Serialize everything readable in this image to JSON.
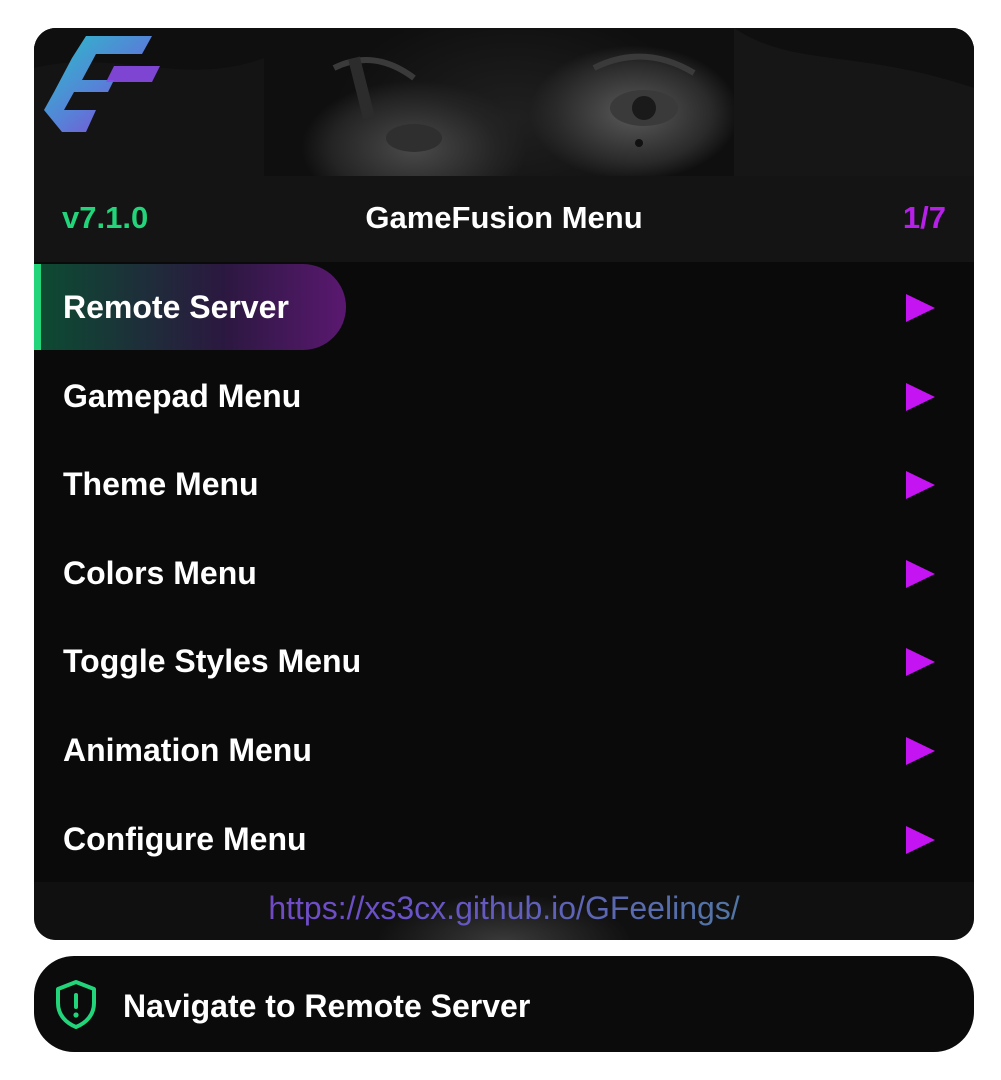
{
  "header": {
    "version": "v7.1.0",
    "title": "GameFusion Menu",
    "page_indicator": "1/7"
  },
  "menu": {
    "selected_index": 0,
    "items": [
      {
        "label": "Remote Server"
      },
      {
        "label": "Gamepad Menu"
      },
      {
        "label": "Theme Menu"
      },
      {
        "label": "Colors Menu"
      },
      {
        "label": "Toggle Styles Menu"
      },
      {
        "label": "Animation Menu"
      },
      {
        "label": "Configure Menu"
      }
    ]
  },
  "footer": {
    "url": "https://xs3cx.github.io/GFeelings/"
  },
  "notification": {
    "icon": "shield-alert-icon",
    "message": "Navigate to Remote Server"
  },
  "colors": {
    "version_green": "#22d47a",
    "accent_purple": "#c414f2",
    "page_purple": "#b620e8",
    "background": "#0a0a0a"
  }
}
